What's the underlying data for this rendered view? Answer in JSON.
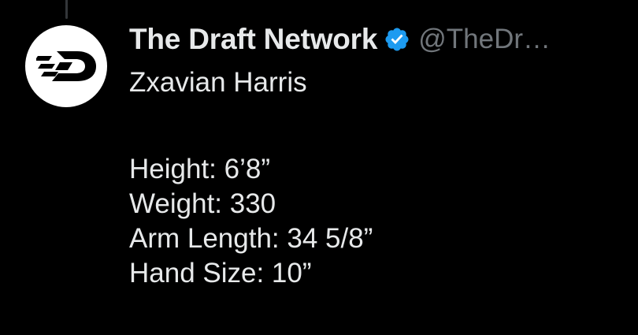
{
  "tweet": {
    "author": {
      "display_name": "The Draft Network",
      "handle": "@TheDr…",
      "verified": true,
      "avatar_icon": "tdn-logo-icon"
    },
    "lines": [
      "Zxavian Harris",
      "Height: 6’8”",
      "Weight: 330",
      "Arm Length: 34 5/8”",
      "Hand Size: 10”"
    ]
  },
  "colors": {
    "background": "#000000",
    "text_primary": "#e7e9ea",
    "text_secondary": "#71767b",
    "verified_blue": "#1d9bf0",
    "thread_line": "#333639"
  }
}
